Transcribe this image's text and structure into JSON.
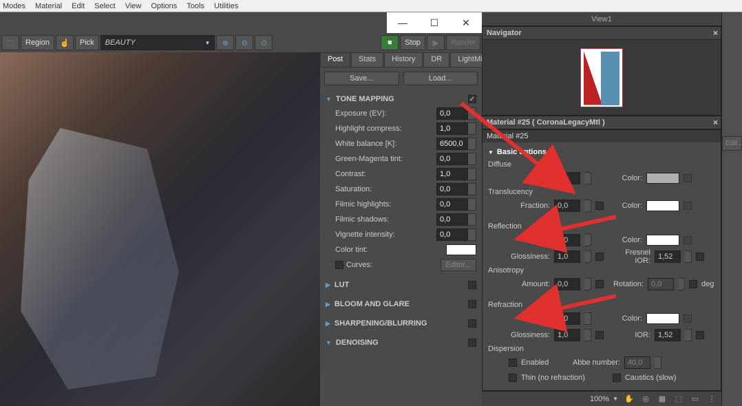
{
  "menu": {
    "items": [
      "Modes",
      "Material",
      "Edit",
      "Select",
      "View",
      "Options",
      "Tools",
      "Utilities"
    ]
  },
  "window_controls": {
    "min": "—",
    "max": "☐",
    "close": "✕"
  },
  "toolbar": {
    "region": "Region",
    "pick": "Pick",
    "mode": "BEAUTY",
    "stop": "Stop",
    "render": "Render"
  },
  "tabs": {
    "items": [
      "Post",
      "Stats",
      "History",
      "DR",
      "LightMix"
    ],
    "active": 0
  },
  "buttons": {
    "save": "Save...",
    "load": "Load..."
  },
  "tone": {
    "title": "TONE MAPPING",
    "exposure": {
      "label": "Exposure (EV):",
      "val": "0,0"
    },
    "highlight": {
      "label": "Highlight compress:",
      "val": "1,0"
    },
    "wb": {
      "label": "White balance [K]:",
      "val": "6500,0"
    },
    "gm": {
      "label": "Green-Magenta tint:",
      "val": "0,0"
    },
    "contrast": {
      "label": "Contrast:",
      "val": "1,0"
    },
    "sat": {
      "label": "Saturation:",
      "val": "0,0"
    },
    "fh": {
      "label": "Filmic highlights:",
      "val": "0,0"
    },
    "fs": {
      "label": "Filmic shadows:",
      "val": "0,0"
    },
    "vig": {
      "label": "Vignette intensity:",
      "val": "0,0"
    },
    "tint": {
      "label": "Color tint:"
    },
    "curves": {
      "label": "Curves:",
      "btn": "Editor..."
    }
  },
  "sections": {
    "lut": "LUT",
    "bloom": "BLOOM AND GLARE",
    "sharp": "SHARPENING/BLURRING",
    "denoise": "DENOISING"
  },
  "right": {
    "view": "View1",
    "navigator": "Navigator",
    "material_title": "Material #25  ( CoronaLegacyMtl )",
    "material_name": "Material #25",
    "basic": "Basic options",
    "diffuse": {
      "title": "Diffuse",
      "level": "Level:",
      "level_val": "0,0",
      "color": "Color:"
    },
    "trans": {
      "title": "Translucency",
      "fraction": "Fraction:",
      "fraction_val": "0,0",
      "color": "Color:"
    },
    "reflection": {
      "title": "Reflection",
      "level": "Level:",
      "level_val": "1,0",
      "color": "Color:",
      "gloss": "Glossiness:",
      "gloss_val": "1,0",
      "fresnel": "Fresnel IOR:",
      "fresnel_val": "1,52",
      "aniso": "Anisotropy",
      "amount": "Amount:",
      "amount_val": "0,0",
      "rotation": "Rotation:",
      "rotation_val": "0,0",
      "deg": "deg"
    },
    "refraction": {
      "title": "Refraction",
      "level": "Level:",
      "level_val": "1,0",
      "color": "Color:",
      "gloss": "Glossiness:",
      "gloss_val": "1,0",
      "ior": "IOR:",
      "ior_val": "1,52",
      "dispersion": "Dispersion",
      "enabled": "Enabled",
      "abbe": "Abbe number:",
      "abbe_val": "40,0",
      "thin": "Thin (no refraction)",
      "caustics": "Caustics (slow)"
    },
    "zoom": "100%",
    "edit": "Edit..."
  }
}
